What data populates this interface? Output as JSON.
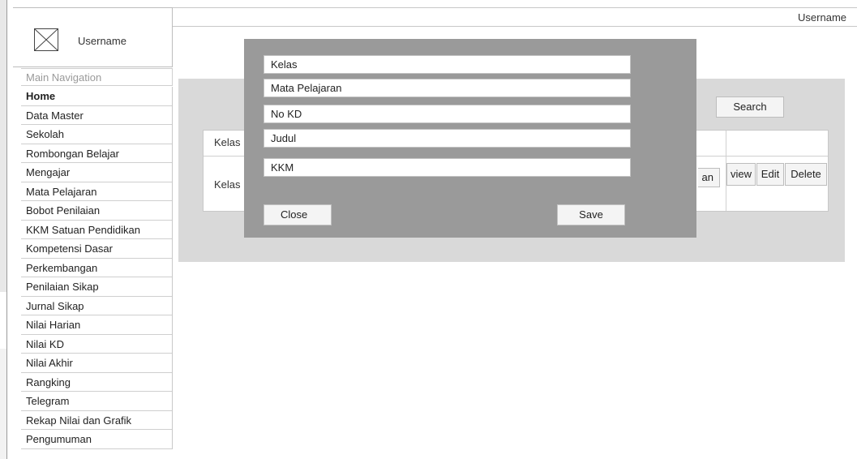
{
  "header": {
    "username": "Username"
  },
  "sidebar": {
    "profile_name": "Username",
    "section_label": "Main Navigation",
    "items": [
      {
        "label": "Home"
      },
      {
        "label": "Data Master"
      },
      {
        "label": "Sekolah"
      },
      {
        "label": "Rombongan Belajar"
      },
      {
        "label": "Mengajar"
      },
      {
        "label": "Mata Pelajaran"
      },
      {
        "label": "Bobot Penilaian"
      },
      {
        "label": "KKM Satuan Pendidikan"
      },
      {
        "label": "Kompetensi Dasar"
      },
      {
        "label": "Perkembangan"
      },
      {
        "label": "Penilaian Sikap"
      },
      {
        "label": "Jurnal Sikap"
      },
      {
        "label": "Nilai Harian"
      },
      {
        "label": "Nilai KD"
      },
      {
        "label": "Nilai Akhir"
      },
      {
        "label": "Rangking"
      },
      {
        "label": "Telegram"
      },
      {
        "label": "Rekap Nilai dan Grafik"
      },
      {
        "label": "Pengumuman"
      }
    ]
  },
  "main": {
    "search_label": "Search",
    "table": {
      "header_first_cell": "Kelas",
      "rows": [
        {
          "first_cell": "Kelas",
          "partial_button": "an",
          "view_label": "view",
          "edit_label": "Edit",
          "delete_label": "Delete"
        }
      ]
    }
  },
  "modal": {
    "fields": [
      {
        "value": "Kelas"
      },
      {
        "value": "Mata Pelajaran"
      },
      {
        "value": "No KD"
      },
      {
        "value": "Judul"
      },
      {
        "value": "KKM"
      }
    ],
    "close_label": "Close",
    "save_label": "Save"
  },
  "colors": {
    "modal_bg": "#9a9a9a",
    "panel_bg": "#d9d9d9",
    "button_bg": "#f4f4f4",
    "border": "#c8c8c8"
  }
}
